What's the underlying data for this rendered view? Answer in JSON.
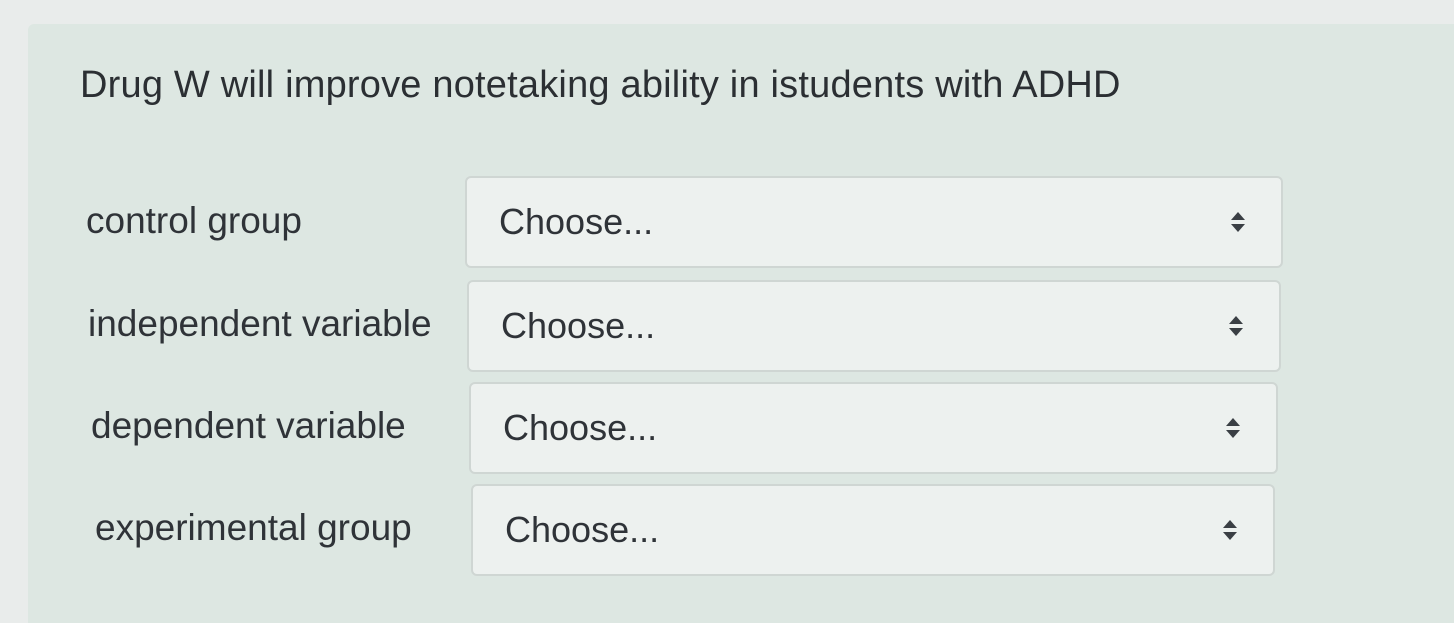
{
  "question": {
    "text": "Drug W will improve notetaking ability in istudents with ADHD"
  },
  "rows": [
    {
      "label": "control group",
      "selected": "Choose..."
    },
    {
      "label": "independent variable",
      "selected": "Choose..."
    },
    {
      "label": "dependent variable",
      "selected": "Choose..."
    },
    {
      "label": "experimental group",
      "selected": "Choose..."
    }
  ],
  "icons": {
    "select_caret": "up-down-caret-icon"
  },
  "colors": {
    "panel": "#dde7e2",
    "select_bg": "#edf1ef",
    "text": "#2f3338"
  }
}
